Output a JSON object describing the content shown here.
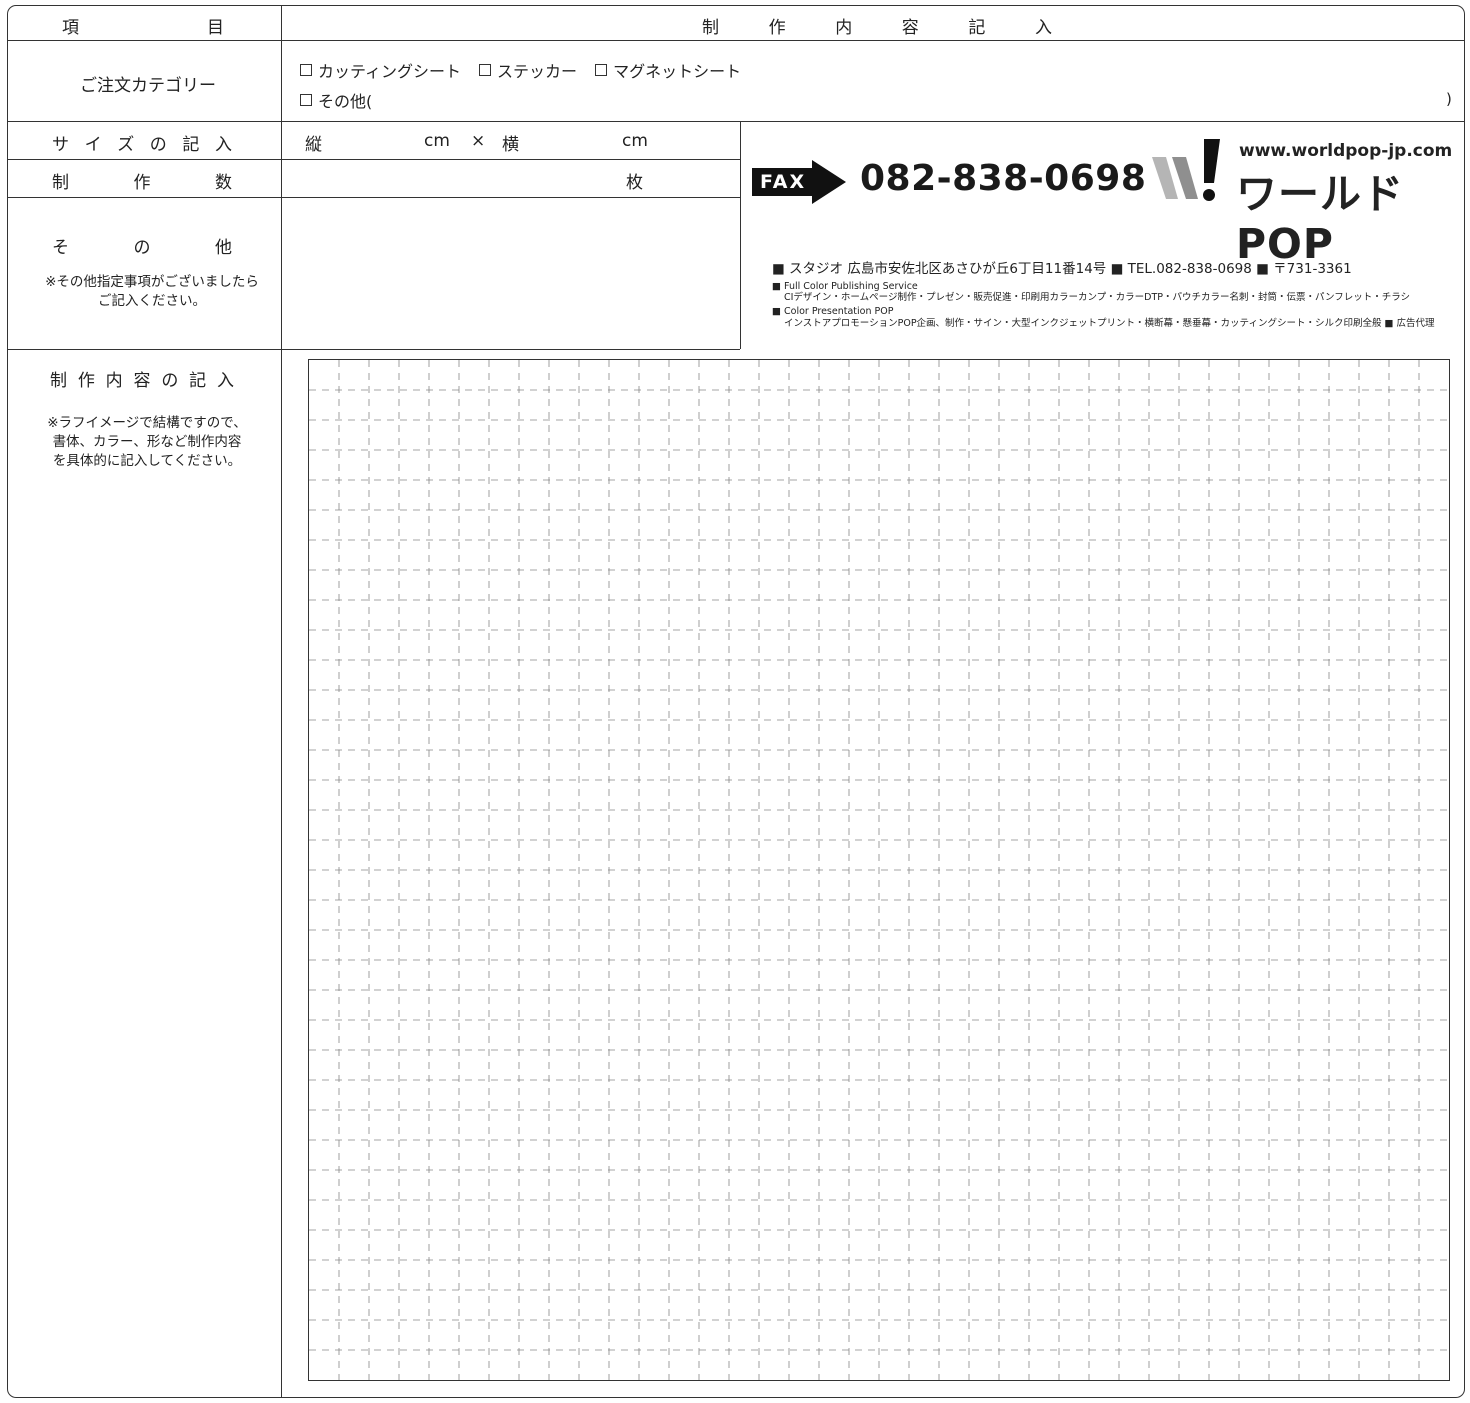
{
  "header": {
    "item_label": [
      "項",
      "目"
    ],
    "content_label": [
      "制",
      "作",
      "内",
      "容",
      "記",
      "入"
    ]
  },
  "category": {
    "label": "ご注文カテゴリー",
    "options": [
      "カッティングシート",
      "ステッカー",
      "マグネットシート",
      "その他("
    ],
    "close_paren": ")"
  },
  "size": {
    "label": [
      "サ",
      "イ",
      "ズ",
      "の",
      "記",
      "入"
    ],
    "vertical": "縦",
    "cm1": "cm",
    "times": "×",
    "horizontal": "横",
    "cm2": "cm"
  },
  "quantity": {
    "label": [
      "制",
      "作",
      "数"
    ],
    "unit": "枚"
  },
  "other": {
    "label": [
      "そ",
      "の",
      "他"
    ],
    "note": "※その他指定事項がございましたら\nご記入ください。"
  },
  "content": {
    "label": [
      "制",
      "作",
      "内",
      "容",
      "の",
      "記",
      "入"
    ],
    "note": "※ラフイメージで結構ですので、\n書体、カラー、形など制作内容\nを具体的に記入してください。"
  },
  "company": {
    "fax_label": "FAX",
    "fax_number": "082-838-0698",
    "url": "www.worldpop-jp.com",
    "brand": "ワールドPOP",
    "address_line": "■ スタジオ 広島市安佐北区あさひが丘6丁目11番14号 ■ TEL.082-838-0698 ■ 〒731-3361",
    "service1_title": "■ Full Color Publishing Service",
    "service1_detail": "CIデザイン・ホームページ制作・プレゼン・販売促進・印刷用カラーカンプ・カラーDTP・パウチカラー名刺・封筒・伝票・パンフレット・チラシ",
    "service2_title": "■ Color Presentation POP",
    "service2_detail": "インストアプロモーションPOP企画、制作・サイン・大型インクジェットプリント・横断幕・懸垂幕・カッティングシート・シルク印刷全般 ■ 広告代理"
  },
  "colors": {
    "line": "#333333",
    "grid_dash": "#888888",
    "brand_gray": "#9a9a9a"
  }
}
